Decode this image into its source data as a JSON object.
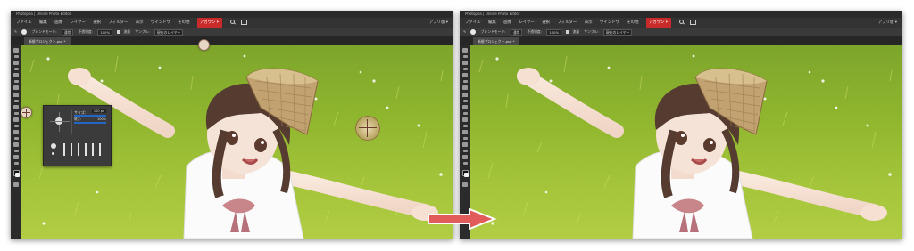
{
  "screens": {
    "left": {
      "window_title": "Photopea | Online Photo Editor",
      "menu": [
        "ファイル",
        "編集",
        "画像",
        "レイヤー",
        "選択",
        "フィルター",
        "表示",
        "ウインドウ",
        "その他",
        "アカウント"
      ],
      "menu_active_index": 9,
      "menu_right": "アプリ版 ▾",
      "options": {
        "blend_label": "ブレンドモード:",
        "blend_value": "通常",
        "opacity_label": "不透明度:",
        "opacity_value": "100%",
        "flow_label": "流量",
        "flow_value": "100%",
        "sample_label": "サンプル:",
        "sample_value": "現在のレイヤー"
      },
      "tab_label": "新規プロジェクト.psd *",
      "brush_panel": {
        "size_label": "サイズ:",
        "size_value": "100 px",
        "hardness_label": "硬さ:",
        "hardness_value": "100%"
      }
    },
    "right": {
      "window_title": "Photopea | Online Photo Editor",
      "menu": [
        "ファイル",
        "編集",
        "画像",
        "レイヤー",
        "選択",
        "フィルター",
        "表示",
        "ウインドウ",
        "その他",
        "アカウント"
      ],
      "menu_active_index": 9,
      "menu_right": "アプリ版 ▾",
      "options": {
        "blend_label": "ブレンドモード:",
        "blend_value": "通常",
        "opacity_label": "不透明度:",
        "opacity_value": "100%",
        "flow_label": "流量",
        "flow_value": "100%",
        "sample_label": "サンプル:",
        "sample_value": "現在のレイヤー"
      },
      "tab_label": "新規プロジェクト.psd *"
    }
  },
  "colors": {
    "menu_active": "#c92a2a",
    "arrow": "#e25b5b",
    "grass": "#9fbe38",
    "brush_slider": "#2466c6"
  },
  "icons": {
    "search": "search-icon",
    "fullscreen": "frame-icon",
    "brush_tool": "brush-icon",
    "arrow": "right-arrow-icon"
  }
}
